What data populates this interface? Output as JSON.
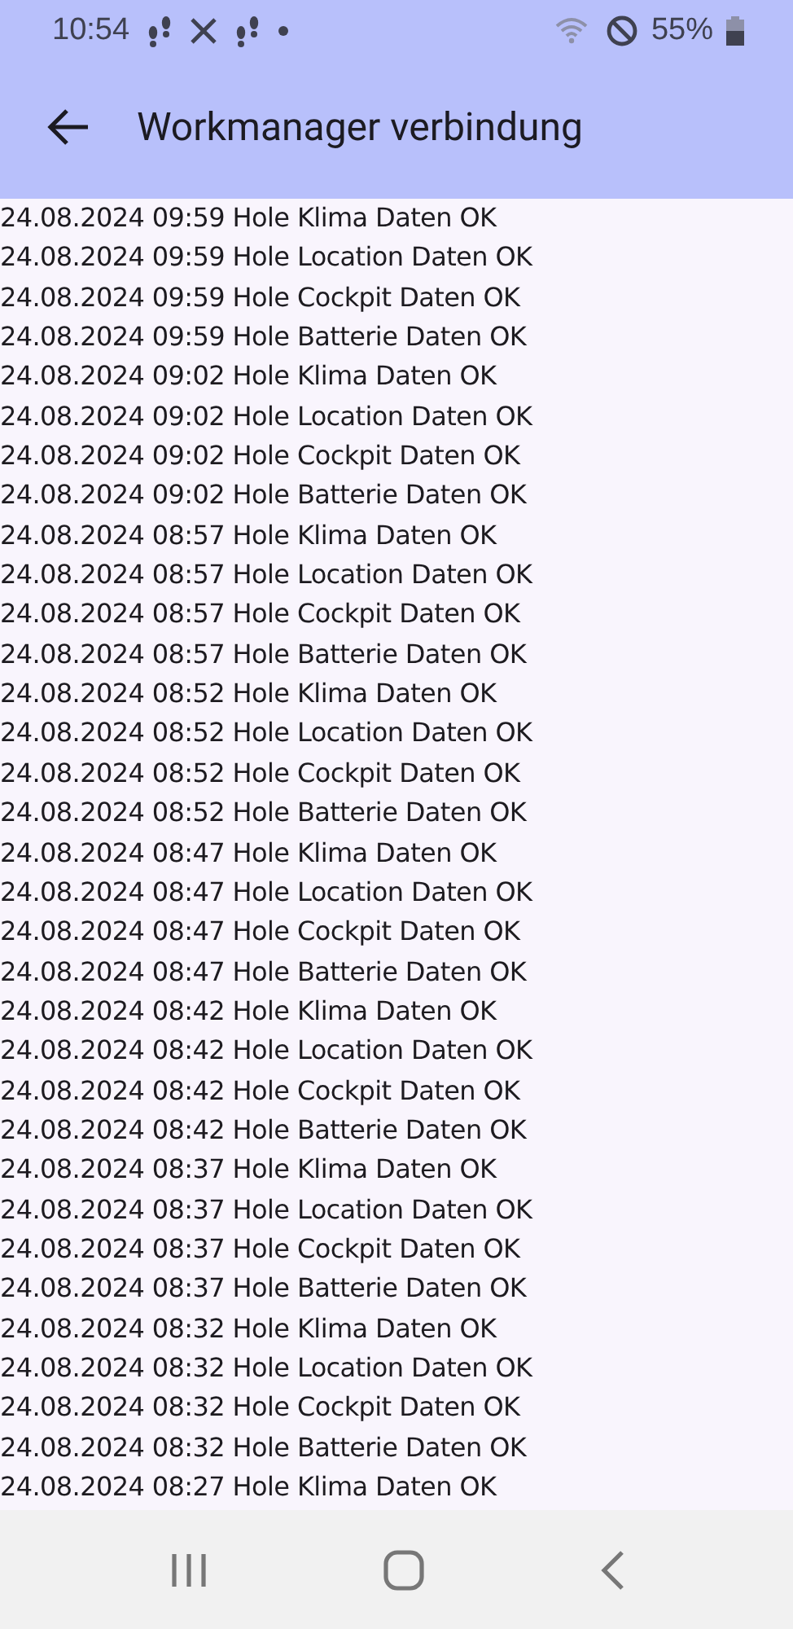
{
  "status_bar": {
    "time": "10:54",
    "battery": "55%"
  },
  "app_bar": {
    "title": "Workmanager verbindung"
  },
  "log_lines": [
    "24.08.2024 09:59 Hole Klima Daten OK",
    "24.08.2024 09:59 Hole Location Daten OK",
    "24.08.2024 09:59 Hole Cockpit Daten OK",
    "24.08.2024 09:59 Hole Batterie Daten OK",
    "24.08.2024 09:02 Hole Klima Daten OK",
    "24.08.2024 09:02 Hole Location Daten OK",
    "24.08.2024 09:02 Hole Cockpit Daten OK",
    "24.08.2024 09:02 Hole Batterie Daten OK",
    "24.08.2024 08:57 Hole Klima Daten OK",
    "24.08.2024 08:57 Hole Location Daten OK",
    "24.08.2024 08:57 Hole Cockpit Daten OK",
    "24.08.2024 08:57 Hole Batterie Daten OK",
    "24.08.2024 08:52 Hole Klima Daten OK",
    "24.08.2024 08:52 Hole Location Daten OK",
    "24.08.2024 08:52 Hole Cockpit Daten OK",
    "24.08.2024 08:52 Hole Batterie Daten OK",
    "24.08.2024 08:47 Hole Klima Daten OK",
    "24.08.2024 08:47 Hole Location Daten OK",
    "24.08.2024 08:47 Hole Cockpit Daten OK",
    "24.08.2024 08:47 Hole Batterie Daten OK",
    "24.08.2024 08:42 Hole Klima Daten OK",
    "24.08.2024 08:42 Hole Location Daten OK",
    "24.08.2024 08:42 Hole Cockpit Daten OK",
    "24.08.2024 08:42 Hole Batterie Daten OK",
    "24.08.2024 08:37 Hole Klima Daten OK",
    "24.08.2024 08:37 Hole Location Daten OK",
    "24.08.2024 08:37 Hole Cockpit Daten OK",
    "24.08.2024 08:37 Hole Batterie Daten OK",
    "24.08.2024 08:32 Hole Klima Daten OK",
    "24.08.2024 08:32 Hole Location Daten OK",
    "24.08.2024 08:32 Hole Cockpit Daten OK",
    "24.08.2024 08:32 Hole Batterie Daten OK",
    "24.08.2024 08:27 Hole Klima Daten OK"
  ]
}
